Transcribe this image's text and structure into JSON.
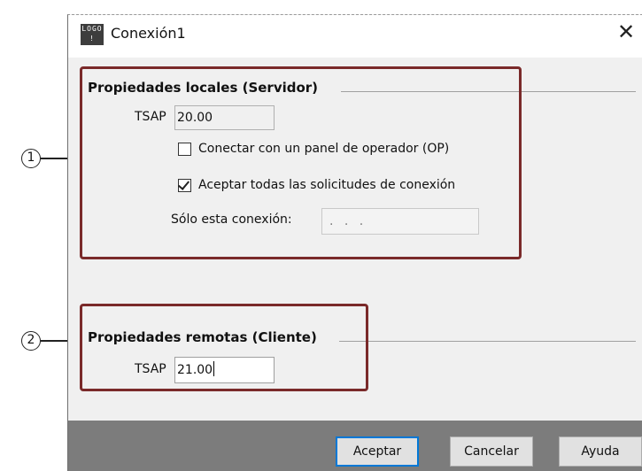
{
  "window": {
    "title": "Conexión1",
    "icon_text": "LOGO!",
    "icon": "logo-app-icon",
    "close_icon": "close-icon"
  },
  "local_group": {
    "heading": "Propiedades locales (Servidor)",
    "tsap_label": "TSAP",
    "tsap_value": "20.00",
    "checkbox_op_label": "Conectar con un panel de operador (OP)",
    "checkbox_op_checked": false,
    "checkbox_accept_label": "Aceptar todas las solicitudes de conexión",
    "checkbox_accept_checked": true,
    "only_connection_label": "Sólo esta conexión:",
    "only_connection_value": ". . ."
  },
  "remote_group": {
    "heading": "Propiedades remotas (Cliente)",
    "tsap_label": "TSAP",
    "tsap_value": "21.00"
  },
  "buttons": {
    "ok": "Aceptar",
    "cancel": "Cancelar",
    "help": "Ayuda"
  },
  "callouts": {
    "one": "1",
    "two": "2"
  },
  "colors": {
    "highlight_border": "#7a2a2a",
    "footer_bg": "#7c7c7c",
    "dialog_bg": "#f0f0f0",
    "default_button_border": "#0078d7"
  }
}
